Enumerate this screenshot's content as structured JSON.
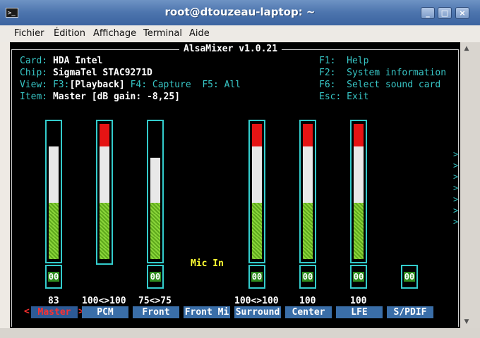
{
  "window": {
    "title": "root@dtouzeau-laptop: ~",
    "icon": "terminal-icon",
    "controls": {
      "minimize": "_",
      "maximize": "□",
      "close": "×"
    }
  },
  "menubar": {
    "items": [
      {
        "label": "Fichier"
      },
      {
        "label": "Édition"
      },
      {
        "label": "Affichage"
      },
      {
        "label": "Terminal"
      },
      {
        "label": "Aide"
      }
    ]
  },
  "alsamixer": {
    "header": "AlsaMixer v1.0.21",
    "info": {
      "card_label": "Card:",
      "card_value": "HDA Intel",
      "chip_label": "Chip:",
      "chip_value": "SigmaTel STAC9271D",
      "view_label": "View:",
      "view_f3": "F3:",
      "view_f3_value": "[Playback]",
      "view_f4": "F4: Capture",
      "view_f5": "F5: All",
      "item_label": "Item:",
      "item_value": "Master [dB gain: -8,25]"
    },
    "keys": [
      {
        "key": "F1:",
        "action": "Help"
      },
      {
        "key": "F2:",
        "action": "System information"
      },
      {
        "key": "F6:",
        "action": "Select sound card"
      },
      {
        "key": "Esc:",
        "action": "Exit"
      }
    ],
    "mic_in_label": "Mic In",
    "channels": [
      {
        "name": "Master",
        "selected": true,
        "value_text": "83",
        "level": 0.83,
        "mute": "00"
      },
      {
        "name": "PCM",
        "selected": false,
        "value_text": "100<>100",
        "level": 1.0,
        "mute": ""
      },
      {
        "name": "Front",
        "selected": false,
        "value_text": "75<>75",
        "level": 0.75,
        "mute": "00"
      },
      {
        "name": "Front Mi",
        "selected": false,
        "value_text": "",
        "level": null,
        "mute": ""
      },
      {
        "name": "Surround",
        "selected": false,
        "value_text": "100<>100",
        "level": 1.0,
        "mute": "00"
      },
      {
        "name": "Center",
        "selected": false,
        "value_text": "100",
        "level": 1.0,
        "mute": "00"
      },
      {
        "name": "LFE",
        "selected": false,
        "value_text": "100",
        "level": 1.0,
        "mute": "00"
      },
      {
        "name": "S/PDIF",
        "selected": false,
        "value_text": "",
        "level": null,
        "mute": "00"
      }
    ],
    "selected_prefix": "<",
    "selected_suffix": ">",
    "more_indicator": ">"
  },
  "colors": {
    "titlebar": "#4c74ad",
    "terminal_bg": "#000000",
    "accent_cyan": "#33cccc",
    "label_bg": "#3a6ea8",
    "meter_red": "#e51414",
    "meter_green": "#6cbf25"
  }
}
